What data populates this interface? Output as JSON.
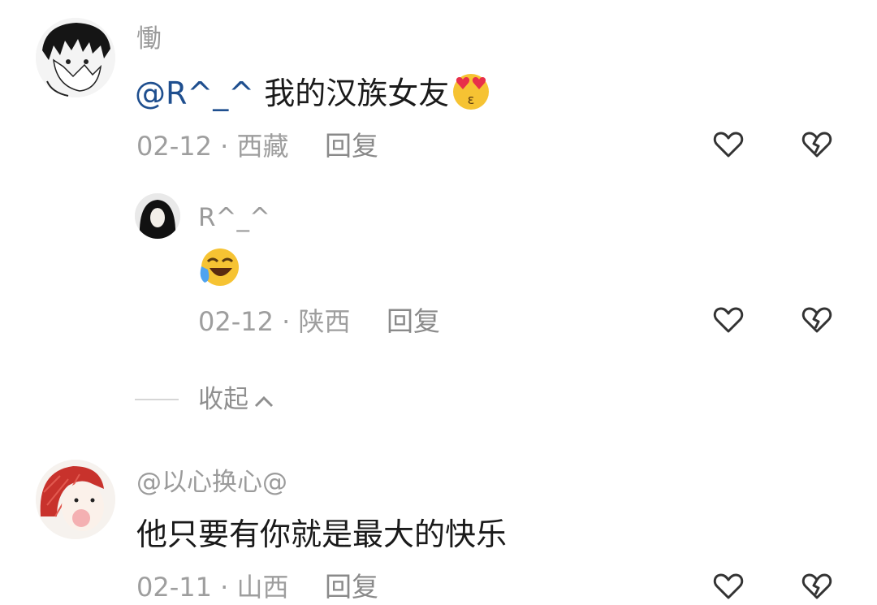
{
  "comments": [
    {
      "username": "慟",
      "mention": "@R^_^",
      "text": "我的汉族女友",
      "emoji": "heart-eyes-kiss-emoji",
      "date": "02-12",
      "sep": "·",
      "location": "西藏",
      "reply_label": "回复",
      "reply": {
        "username": "R^_^",
        "emoji": "rofl-laughing-emoji",
        "date": "02-12",
        "sep": "·",
        "location": "陕西",
        "reply_label": "回复"
      }
    },
    {
      "username": "@以心换心@",
      "text": "他只要有你就是最大的快乐",
      "date": "02-11",
      "sep": "·",
      "location": "山西",
      "reply_label": "回复"
    }
  ],
  "collapse_label": "收起",
  "colors": {
    "mention": "#1f4f8f",
    "meta": "#9e9e9e",
    "icon": "#333333"
  }
}
